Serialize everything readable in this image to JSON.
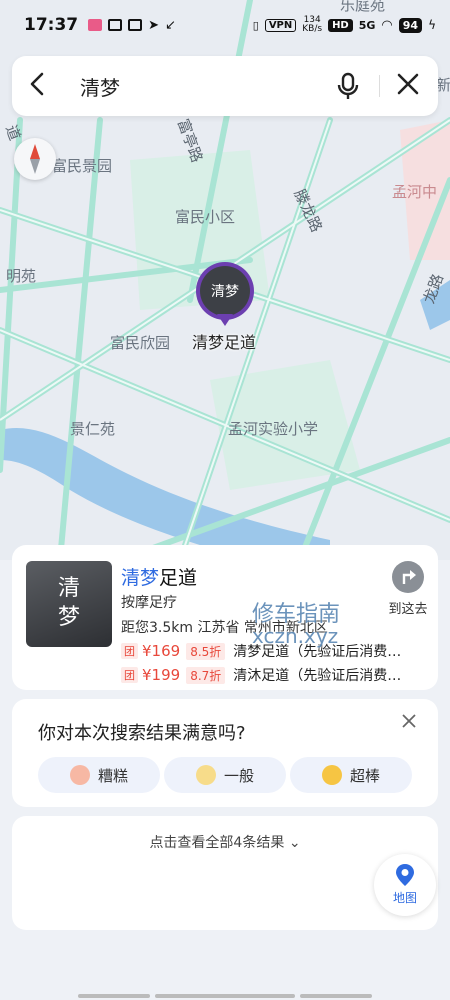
{
  "status_bar": {
    "time": "17:37",
    "net_speed": "134\nKB/s",
    "vpn": "VPN",
    "hd": "HD",
    "signal": "5G",
    "battery": "94"
  },
  "search": {
    "query": "清梦"
  },
  "map": {
    "labels": [
      "富民景园",
      "富民小区",
      "明苑",
      "富民欣园",
      "景仁苑",
      "孟河实验小学",
      "孟河中",
      "乐庭苑",
      "新"
    ],
    "roads": [
      "富亭路",
      "滕龙路",
      "龙路",
      "道"
    ],
    "marker": {
      "name": "清梦足道",
      "icon_text": "清梦"
    }
  },
  "result": {
    "thumb_text": [
      "清",
      "梦"
    ],
    "title_highlight": "清梦",
    "title_rest": "足道",
    "category": "按摩足疗",
    "distance": "距您3.5km  江苏省 常州市新北区",
    "deals": [
      {
        "tag": "团",
        "price": "¥169",
        "discount": "8.5折",
        "name": "清梦足道（先验证后消费…"
      },
      {
        "tag": "团",
        "price": "¥199",
        "discount": "8.7折",
        "name": "清沐足道（先验证后消费…"
      }
    ],
    "go_label": "到这去",
    "watermark_1": "修车指南",
    "watermark_2": "xczn.xyz"
  },
  "feedback": {
    "question": "你对本次搜索结果满意吗?",
    "options": [
      "糟糕",
      "一般",
      "超棒"
    ]
  },
  "more": {
    "text": "点击查看全部4条结果",
    "map_button": "地图"
  },
  "colors": {
    "accent": "#2f6be0",
    "marker": "#6c3fb0",
    "price": "#e8483b",
    "road": "#a9e4d4"
  }
}
